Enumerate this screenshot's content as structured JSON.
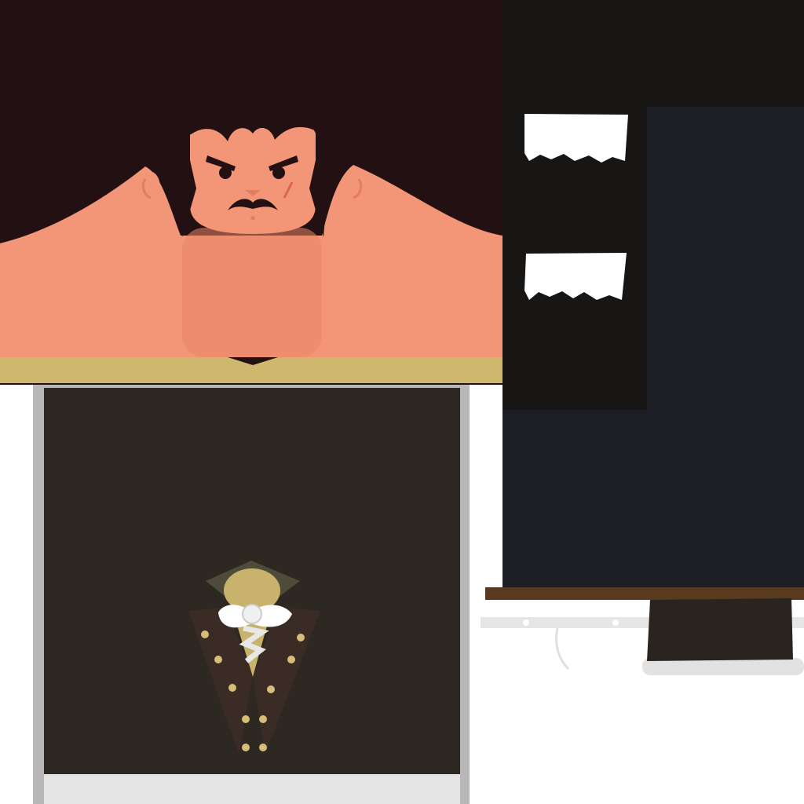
{
  "atlas": {
    "regions": [
      {
        "id": "head-skin",
        "depicts": "face-and-shoulders"
      },
      {
        "id": "sleeve-cuffs",
        "depicts": "white-cuffs-on-black"
      },
      {
        "id": "trousers",
        "depicts": "navy-fabric"
      },
      {
        "id": "coat-front",
        "depicts": "double-breasted-coat-with-cravat"
      },
      {
        "id": "shoe-and-belt",
        "depicts": "brown-belt-and-dark-shoe"
      }
    ]
  },
  "colors": {
    "hair": "#231012",
    "skin": "#f39577",
    "skin_shadow": "#e88668",
    "gold_band": "#cfb86d",
    "cuff_black": "#181614",
    "cuff_white": "#ffffff",
    "trouser_navy": "#1c1d25",
    "coat_brown": "#2e2823",
    "coat_frame_grey": "#b8b8b8",
    "button_gold": "#d6bd78",
    "lapel": "#3a2c24",
    "collar_green": "#4e4b3a",
    "belt_brown": "#5a3a1f",
    "shoe": "#29241f"
  }
}
